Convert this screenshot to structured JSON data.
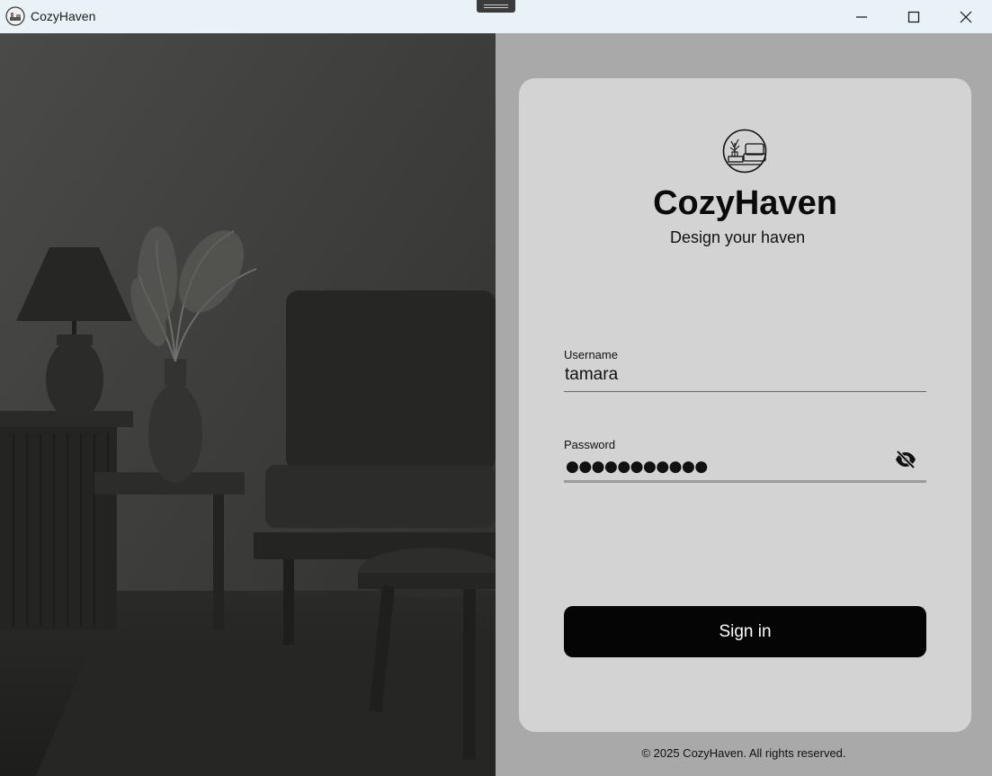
{
  "window": {
    "title": "CozyHaven",
    "minimize_icon": "minimize-icon",
    "maximize_icon": "maximize-icon",
    "close_icon": "close-icon"
  },
  "login": {
    "brand": "CozyHaven",
    "tagline": "Design your haven",
    "username": {
      "label": "Username",
      "value": "tamara"
    },
    "password": {
      "label": "Password",
      "masked_value": "●●●●●●●●●●●",
      "toggle_icon": "eye-off-icon"
    },
    "submit_label": "Sign in"
  },
  "footer": {
    "text": "© 2025 CozyHaven. All rights reserved."
  },
  "colors": {
    "titlebar": "#e9f3f7",
    "background": "#a9a9a9",
    "card": "#d3d3d3",
    "button": "#050505"
  }
}
